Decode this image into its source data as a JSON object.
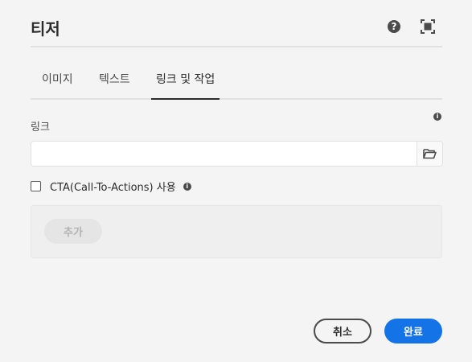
{
  "dialog": {
    "title": "티저",
    "help_glyph": "?",
    "icons": [
      "help-icon",
      "fullscreen-icon"
    ]
  },
  "tabs": [
    {
      "label": "이미지",
      "active": false
    },
    {
      "label": "텍스트",
      "active": false
    },
    {
      "label": "링크 및 작업",
      "active": true
    }
  ],
  "link_field": {
    "label": "링크",
    "value": "",
    "placeholder": "",
    "info_glyph": "i",
    "browse_icon": "folder-icon"
  },
  "cta": {
    "checked": false,
    "label": "CTA(Call-To-Actions) 사용",
    "info_glyph": "i"
  },
  "multifield": {
    "add_label": "추가"
  },
  "footer": {
    "cancel_label": "취소",
    "done_label": "완료"
  },
  "colors": {
    "background": "#f4f4f4",
    "accent": "#1473e6",
    "text": "#2c2c2c",
    "divider": "#e1e1e1"
  }
}
